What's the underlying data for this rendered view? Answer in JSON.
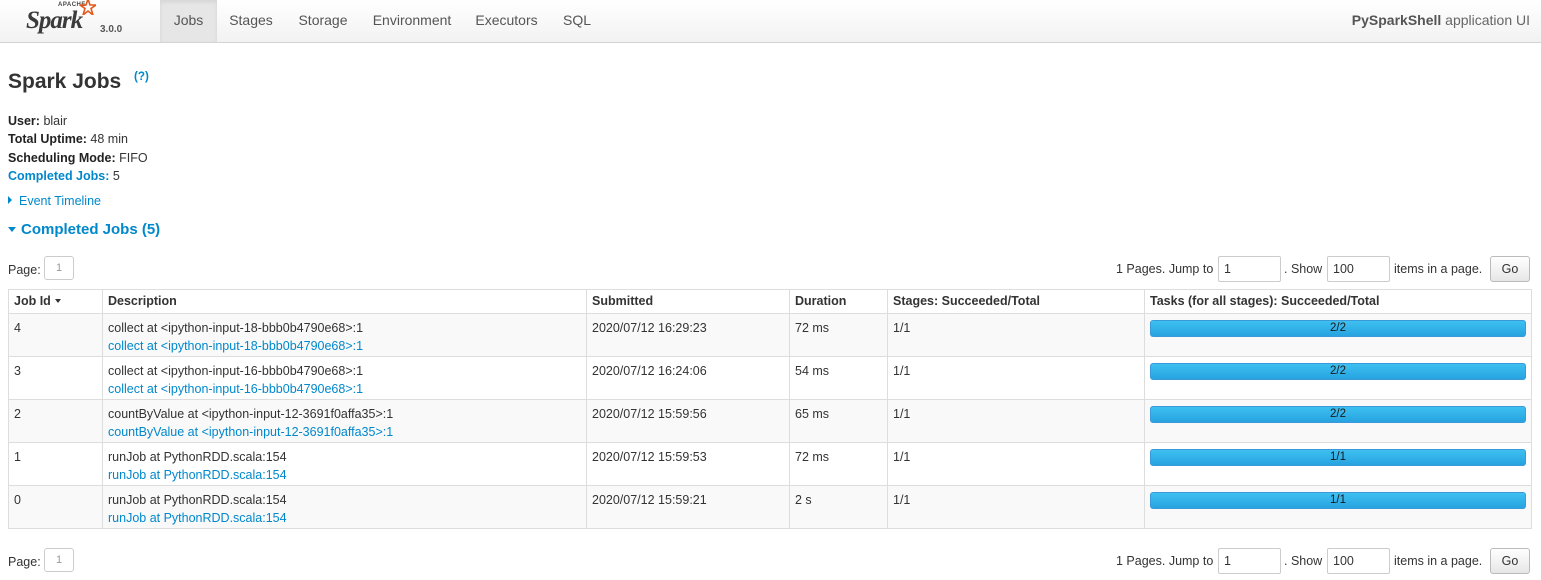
{
  "brand": {
    "apache": "APACHE",
    "name": "Spark",
    "version": "3.0.0"
  },
  "nav": {
    "tabs": [
      {
        "label": "Jobs",
        "active": true
      },
      {
        "label": "Stages",
        "active": false
      },
      {
        "label": "Storage",
        "active": false
      },
      {
        "label": "Environment",
        "active": false
      },
      {
        "label": "Executors",
        "active": false
      },
      {
        "label": "SQL",
        "active": false
      }
    ],
    "app_name": "PySparkShell",
    "app_suffix": "application UI"
  },
  "page": {
    "title": "Spark Jobs",
    "help": "(?)",
    "summary": {
      "user_label": "User:",
      "user": "blair",
      "uptime_label": "Total Uptime:",
      "uptime": "48 min",
      "sched_label": "Scheduling Mode:",
      "sched": "FIFO",
      "completed_label": "Completed Jobs:",
      "completed": "5"
    },
    "event_timeline": "Event Timeline",
    "completed_header": "Completed Jobs (5)"
  },
  "pagination": {
    "page_label": "Page:",
    "page": "1",
    "pages_text": "1 Pages. Jump to",
    "jump_value": "1",
    "show_text": ". Show",
    "show_value": "100",
    "items_text": "items in a page.",
    "go": "Go"
  },
  "table": {
    "headers": [
      "Job Id",
      "Description",
      "Submitted",
      "Duration",
      "Stages: Succeeded/Total",
      "Tasks (for all stages): Succeeded/Total"
    ],
    "rows": [
      {
        "id": "4",
        "desc": "collect at <ipython-input-18-bbb0b4790e68>:1",
        "link": "collect at <ipython-input-18-bbb0b4790e68>:1",
        "submitted": "2020/07/12 16:29:23",
        "duration": "72 ms",
        "stages": "1/1",
        "tasks": "2/2",
        "progress": 1.0
      },
      {
        "id": "3",
        "desc": "collect at <ipython-input-16-bbb0b4790e68>:1",
        "link": "collect at <ipython-input-16-bbb0b4790e68>:1",
        "submitted": "2020/07/12 16:24:06",
        "duration": "54 ms",
        "stages": "1/1",
        "tasks": "2/2",
        "progress": 1.0
      },
      {
        "id": "2",
        "desc": "countByValue at <ipython-input-12-3691f0affa35>:1",
        "link": "countByValue at <ipython-input-12-3691f0affa35>:1",
        "submitted": "2020/07/12 15:59:56",
        "duration": "65 ms",
        "stages": "1/1",
        "tasks": "2/2",
        "progress": 1.0
      },
      {
        "id": "1",
        "desc": "runJob at PythonRDD.scala:154",
        "link": "runJob at PythonRDD.scala:154",
        "submitted": "2020/07/12 15:59:53",
        "duration": "72 ms",
        "stages": "1/1",
        "tasks": "1/1",
        "progress": 1.0
      },
      {
        "id": "0",
        "desc": "runJob at PythonRDD.scala:154",
        "link": "runJob at PythonRDD.scala:154",
        "submitted": "2020/07/12 15:59:21",
        "duration": "2 s",
        "stages": "1/1",
        "tasks": "1/1",
        "progress": 1.0
      }
    ]
  },
  "colors": {
    "link": "#0088cc",
    "progress": "#27a3e0"
  },
  "icons": {
    "brand_star": "spark-star-icon",
    "sort": "sort-desc-icon",
    "expand": "triangle-right-icon",
    "collapse": "triangle-down-icon"
  }
}
